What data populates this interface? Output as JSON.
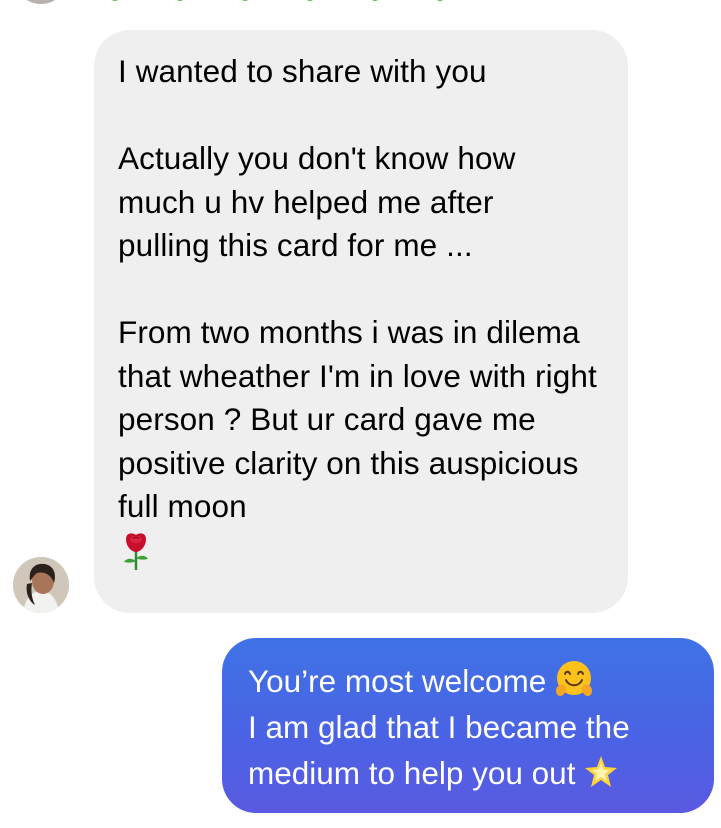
{
  "incoming_message": {
    "paragraph_1": "I wanted to share with you",
    "paragraph_2": "Actually you don't know how much u hv helped me after pulling this card for me ...",
    "paragraph_3": "From two months i was in dilema that wheather I'm in love with right person ? But ur card gave me positive clarity on this auspicious full moon",
    "trailing_emoji": "rose-emoji"
  },
  "outgoing_message": {
    "line_1": "You’re most welcome",
    "line_1_emoji": "hugging-face-emoji",
    "line_2": "I am glad that I became the",
    "line_3": "medium to help you out",
    "line_3_emoji": "glowing-star-emoji"
  },
  "colors": {
    "incoming_bubble": "#efefef",
    "outgoing_bubble_top": "#3f72e6",
    "outgoing_bubble_bottom": "#5a5ae2"
  }
}
